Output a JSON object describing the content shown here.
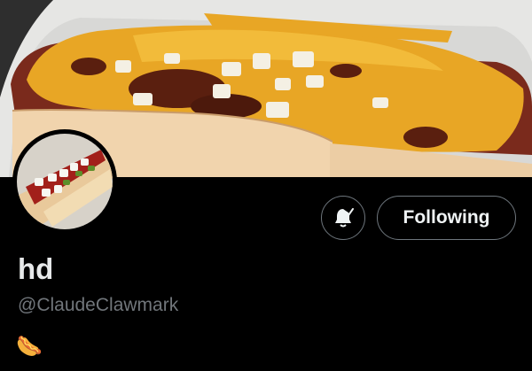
{
  "profile": {
    "banner_image": "hot-dog-with-chili-cheese-onions",
    "avatar_image": "hot-dog-with-tomato-onions-pickles",
    "display_name": "hd",
    "handle": "@ClaudeClawmark",
    "bio": "🌭"
  },
  "actions": {
    "notifications_icon": "bell-subscribed-icon",
    "follow_label": "Following"
  },
  "colors": {
    "background": "#000000",
    "button_border": "#6e767d",
    "handle_text": "#71767b",
    "primary_text": "#e7e9ea"
  }
}
